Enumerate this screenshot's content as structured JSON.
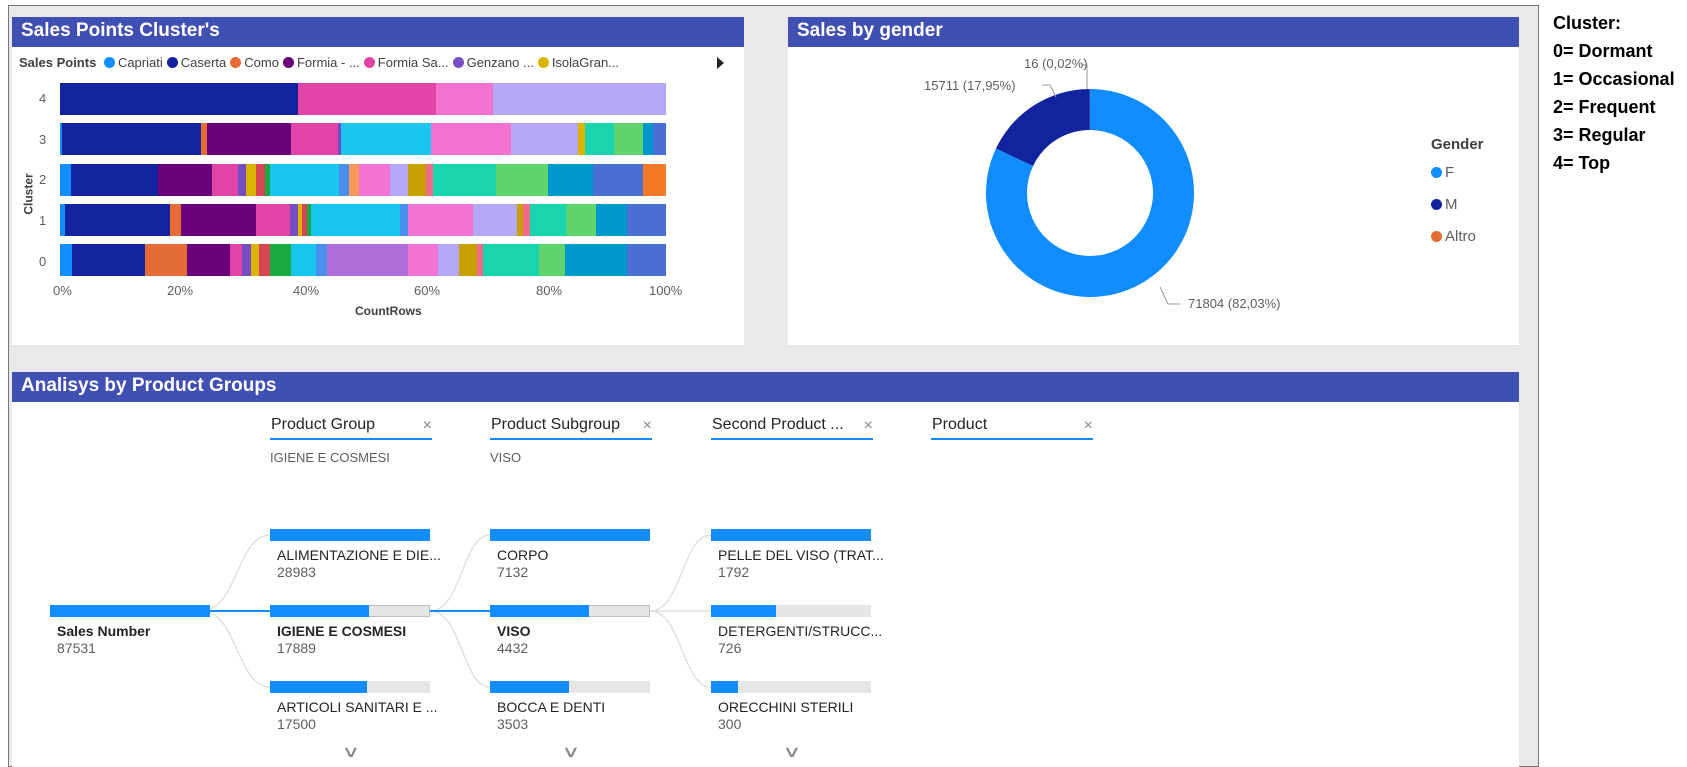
{
  "side_note": [
    "Cluster:",
    "0= Dormant",
    "1= Occasional",
    "2= Frequent",
    "3= Regular",
    "4= Top"
  ],
  "cluster_panel": {
    "title": "Sales Points Cluster's",
    "legend_title": "Sales Points",
    "legend": [
      {
        "label": "Capriati",
        "color": "#118dff"
      },
      {
        "label": "Caserta",
        "color": "#12239e"
      },
      {
        "label": "Como",
        "color": "#e66c37"
      },
      {
        "label": "Formia - ...",
        "color": "#6b007b"
      },
      {
        "label": "Formia Sa...",
        "color": "#e044a7"
      },
      {
        "label": "Genzano ...",
        "color": "#744ec2"
      },
      {
        "label": "IsolaGran...",
        "color": "#d9b300"
      }
    ]
  },
  "gender_panel": {
    "title": "Sales by gender",
    "legend_title": "Gender",
    "legend": [
      {
        "label": "F",
        "color": "#118dff"
      },
      {
        "label": "M",
        "color": "#12239e"
      },
      {
        "label": "Altro",
        "color": "#e66c37"
      }
    ],
    "labels": {
      "f": "71804 (82,03%)",
      "m": "15711 (17,95%)",
      "altro": "16 (0,02%)"
    }
  },
  "analysis_panel": {
    "title": "Analisys by Product Groups",
    "levels": [
      {
        "header": "Product Group",
        "sub": "IGIENE E COSMESI"
      },
      {
        "header": "Product Subgroup",
        "sub": "VISO"
      },
      {
        "header": "Second Product ...",
        "sub": ""
      },
      {
        "header": "Product",
        "sub": ""
      }
    ],
    "root": {
      "label": "Sales Number",
      "value": "87531"
    },
    "col1": [
      {
        "label": "ALIMENTAZIONE E DIE...",
        "value": "28983",
        "fill": 1.0
      },
      {
        "label": "IGIENE E COSMESI",
        "value": "17889",
        "fill": 0.617
      },
      {
        "label": "ARTICOLI SANITARI E ...",
        "value": "17500",
        "fill": 0.604
      }
    ],
    "col2": [
      {
        "label": "CORPO",
        "value": "7132",
        "fill": 1.0
      },
      {
        "label": "VISO",
        "value": "4432",
        "fill": 0.621
      },
      {
        "label": "BOCCA E DENTI",
        "value": "3503",
        "fill": 0.491
      }
    ],
    "col3": [
      {
        "label": "PELLE DEL VISO (TRAT...",
        "value": "1792",
        "fill": 1.0
      },
      {
        "label": "DETERGENTI/STRUCC...",
        "value": "726",
        "fill": 0.405
      },
      {
        "label": "ORECCHINI STERILI",
        "value": "300",
        "fill": 0.167
      }
    ],
    "close_glyph": "×",
    "chevron_glyph": "∨"
  },
  "chart_data": [
    {
      "type": "bar",
      "orientation": "horizontal",
      "stacked": "100%",
      "categories": [
        "4",
        "3",
        "2",
        "1",
        "0"
      ],
      "xlabel": "CountRows",
      "ylabel": "Cluster",
      "x_ticks": [
        "0%",
        "20%",
        "40%",
        "60%",
        "80%",
        "100%"
      ],
      "y_ticks": [
        "4",
        "3",
        "2",
        "1",
        "0"
      ],
      "series_note": "segment fractions per cluster row; series beyond the 7 legend entries are unnamed in the image",
      "rows": {
        "4": [
          {
            "f": 0.392,
            "c": "#12239e"
          },
          {
            "f": 0.228,
            "c": "#e044a7"
          },
          {
            "f": 0.095,
            "c": "#f472d0"
          },
          {
            "f": 0.285,
            "c": "#b4a7f5"
          }
        ],
        "3": [
          {
            "f": 0.004,
            "c": "#118dff"
          },
          {
            "f": 0.229,
            "c": "#12239e"
          },
          {
            "f": 0.009,
            "c": "#e66c37"
          },
          {
            "f": 0.14,
            "c": "#6b007b"
          },
          {
            "f": 0.077,
            "c": "#e044a7"
          },
          {
            "f": 0.004,
            "c": "#744ec2"
          },
          {
            "f": 0.149,
            "c": "#1ac6ef"
          },
          {
            "f": 0.133,
            "c": "#f472d0"
          },
          {
            "f": 0.11,
            "c": "#b4a7f5"
          },
          {
            "f": 0.011,
            "c": "#d9b300"
          },
          {
            "f": 0.049,
            "c": "#1ad4b0"
          },
          {
            "f": 0.047,
            "c": "#5fd46c"
          },
          {
            "f": 0.017,
            "c": "#0097cc"
          },
          {
            "f": 0.021,
            "c": "#4a6fd4"
          }
        ],
        "2": [
          {
            "f": 0.018,
            "c": "#118dff"
          },
          {
            "f": 0.143,
            "c": "#12239e"
          },
          {
            "f": 0.089,
            "c": "#6b007b"
          },
          {
            "f": 0.043,
            "c": "#e044a7"
          },
          {
            "f": 0.014,
            "c": "#744ec2"
          },
          {
            "f": 0.016,
            "c": "#d9b300"
          },
          {
            "f": 0.016,
            "c": "#d64550"
          },
          {
            "f": 0.008,
            "c": "#1aab40"
          },
          {
            "f": 0.113,
            "c": "#1ac6ef"
          },
          {
            "f": 0.017,
            "c": "#4a8ff0"
          },
          {
            "f": 0.016,
            "c": "#f59a5b"
          },
          {
            "f": 0.052,
            "c": "#f472d0"
          },
          {
            "f": 0.03,
            "c": "#b4a7f5"
          },
          {
            "f": 0.029,
            "c": "#c79f00"
          },
          {
            "f": 0.012,
            "c": "#f06b8a"
          },
          {
            "f": 0.104,
            "c": "#1ad4b0"
          },
          {
            "f": 0.085,
            "c": "#5fd46c"
          },
          {
            "f": 0.075,
            "c": "#0097cc"
          },
          {
            "f": 0.082,
            "c": "#4a6fd4"
          },
          {
            "f": 0.038,
            "c": "#f57a25"
          }
        ],
        "1": [
          {
            "f": 0.008,
            "c": "#118dff"
          },
          {
            "f": 0.172,
            "c": "#12239e"
          },
          {
            "f": 0.017,
            "c": "#e66c37"
          },
          {
            "f": 0.124,
            "c": "#6b007b"
          },
          {
            "f": 0.055,
            "c": "#e044a7"
          },
          {
            "f": 0.012,
            "c": "#744ec2"
          },
          {
            "f": 0.007,
            "c": "#d9b300"
          },
          {
            "f": 0.008,
            "c": "#d64550"
          },
          {
            "f": 0.007,
            "c": "#1aab40"
          },
          {
            "f": 0.145,
            "c": "#1ac6ef"
          },
          {
            "f": 0.013,
            "c": "#4a8ff0"
          },
          {
            "f": 0.106,
            "c": "#f472d0"
          },
          {
            "f": 0.073,
            "c": "#b4a7f5"
          },
          {
            "f": 0.01,
            "c": "#c79f00"
          },
          {
            "f": 0.011,
            "c": "#f06b8a"
          },
          {
            "f": 0.059,
            "c": "#1ad4b0"
          },
          {
            "f": 0.049,
            "c": "#5fd46c"
          },
          {
            "f": 0.05,
            "c": "#0097cc"
          },
          {
            "f": 0.064,
            "c": "#4a6fd4"
          }
        ],
        "0": [
          {
            "f": 0.02,
            "c": "#118dff"
          },
          {
            "f": 0.121,
            "c": "#12239e"
          },
          {
            "f": 0.07,
            "c": "#e66c37"
          },
          {
            "f": 0.071,
            "c": "#6b007b"
          },
          {
            "f": 0.02,
            "c": "#e044a7"
          },
          {
            "f": 0.015,
            "c": "#744ec2"
          },
          {
            "f": 0.013,
            "c": "#d9b300"
          },
          {
            "f": 0.018,
            "c": "#d64550"
          },
          {
            "f": 0.035,
            "c": "#1aab40"
          },
          {
            "f": 0.041,
            "c": "#1ac6ef"
          },
          {
            "f": 0.018,
            "c": "#4a8ff0"
          },
          {
            "f": 0.135,
            "c": "#b06fd8"
          },
          {
            "f": 0.05,
            "c": "#f472d0"
          },
          {
            "f": 0.035,
            "c": "#b4a7f5"
          },
          {
            "f": 0.03,
            "c": "#c79f00"
          },
          {
            "f": 0.01,
            "c": "#f06b8a"
          },
          {
            "f": 0.092,
            "c": "#1ad4b0"
          },
          {
            "f": 0.044,
            "c": "#5fd46c"
          },
          {
            "f": 0.103,
            "c": "#0097cc"
          },
          {
            "f": 0.064,
            "c": "#4a6fd4"
          }
        ]
      }
    },
    {
      "type": "pie",
      "donut": true,
      "title": "Sales by gender",
      "categories": [
        "F",
        "M",
        "Altro"
      ],
      "values": [
        71804,
        15711,
        16
      ],
      "percent_labels": [
        "82,03%",
        "17,95%",
        "0,02%"
      ],
      "colors": [
        "#118dff",
        "#12239e",
        "#e66c37"
      ]
    }
  ]
}
